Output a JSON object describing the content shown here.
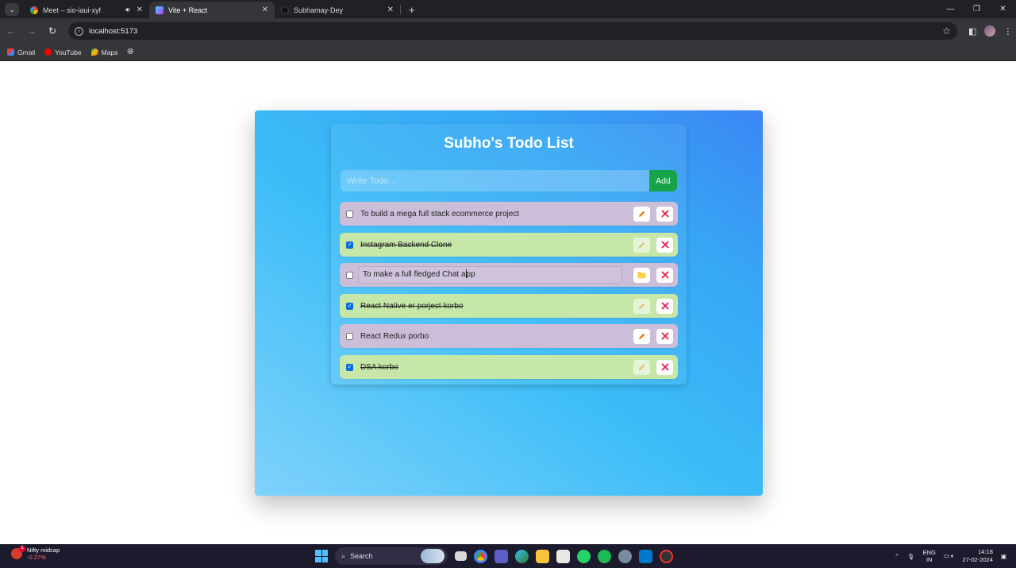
{
  "browser": {
    "tabs": [
      {
        "title": "Meet – sio-iaui-xyf",
        "active": false,
        "audio": true
      },
      {
        "title": "Vite + React",
        "active": true,
        "audio": false
      },
      {
        "title": "Subhamay-Dey",
        "active": false,
        "audio": false
      }
    ],
    "url": "localhost:5173",
    "bookmarks": [
      {
        "label": "Gmail"
      },
      {
        "label": "YouTube"
      },
      {
        "label": "Maps"
      }
    ]
  },
  "app": {
    "title": "Subho's Todo List",
    "input_placeholder": "Write Todo...",
    "add_label": "Add",
    "todos": [
      {
        "text": "To build a mega full stack ecommerce project",
        "completed": false,
        "editing": false
      },
      {
        "text": "Instagram Backend Clone",
        "completed": true,
        "editing": false
      },
      {
        "text_before_caret": "To make a full fledged Chat a",
        "text_after_caret": "pp",
        "completed": false,
        "editing": true
      },
      {
        "text": "React Native er porject korbo",
        "completed": true,
        "editing": false
      },
      {
        "text": "React Redux porbo",
        "completed": false,
        "editing": false
      },
      {
        "text": "DSA korbo",
        "completed": true,
        "editing": false
      }
    ],
    "colors": {
      "pending": "#ccbed9",
      "done": "#c6e7a8",
      "add_button": "#16a34a",
      "delete_icon": "#e11d48"
    }
  },
  "taskbar": {
    "widget_title": "Nifty midcap",
    "widget_value": "-0.27%",
    "search_label": "Search",
    "lang_top": "ENG",
    "lang_bottom": "IN",
    "time": "14:18",
    "date": "27-02-2024"
  }
}
